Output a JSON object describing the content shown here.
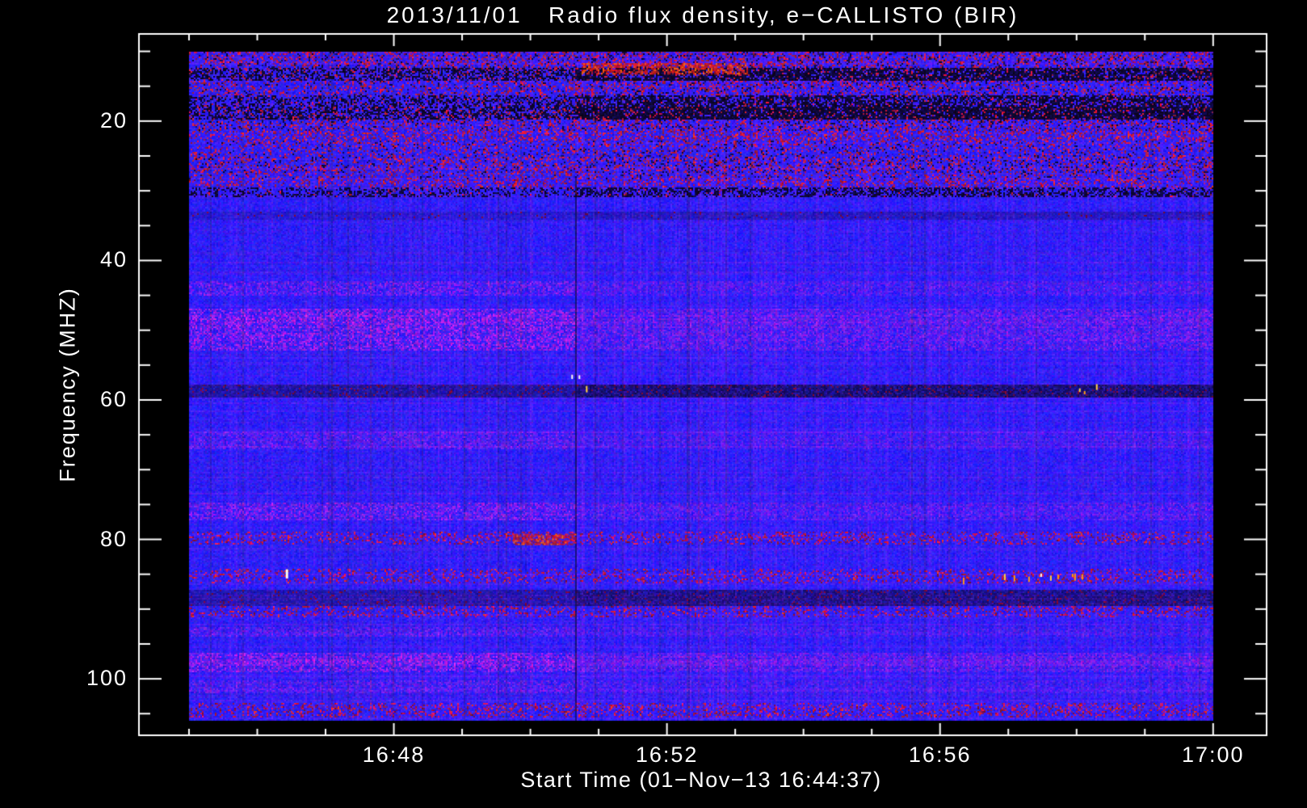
{
  "chart_data": {
    "type": "heatmap",
    "title": "2013/11/01   Radio flux density, e−CALLISTO (BIR)",
    "xlabel": "Start Time (01−Nov−13 16:44:37)",
    "ylabel": "Frequency (MHZ)",
    "x_axis": {
      "start": "16:44:16",
      "end": "17:00:47",
      "minor_step_min": 1,
      "major_ticks": [
        {
          "time": "16:48",
          "label": "16:48"
        },
        {
          "time": "16:52",
          "label": "16:52"
        },
        {
          "time": "16:56",
          "label": "16:56"
        },
        {
          "time": "17:00",
          "label": "17:00"
        }
      ]
    },
    "y_axis": {
      "min": 7.5,
      "max": 108.1,
      "unit": "MHz",
      "direction": "increasing-downward",
      "minor_step": 5,
      "major_ticks": [
        {
          "value": 20,
          "label": "20"
        },
        {
          "value": 40,
          "label": "40"
        },
        {
          "value": 60,
          "label": "60"
        },
        {
          "value": 80,
          "label": "80"
        },
        {
          "value": 100,
          "label": "100"
        }
      ]
    },
    "data_window": {
      "t0": "16:45:00",
      "t1": "17:00:00",
      "f0": 10.0,
      "f1": 106.0
    },
    "palette": {
      "background": "#000000",
      "frame": "#ffffff",
      "text": "#ffffff",
      "base_blue": "#2a2af0",
      "purple": "#7a24c8",
      "red": "#cc1616",
      "bright_red": "#ff3c00",
      "orange": "#ff9a12",
      "yellow": "#ffd440",
      "white_hot": "#fffdf0",
      "dark": "#05051e"
    },
    "segments": [
      {
        "t0": "16:45:00",
        "t1": "16:50:40",
        "purple_boost": 1.3,
        "red_striation": 0.25,
        "dark_boost": 0.75,
        "gain": 0.97
      },
      {
        "t0": "16:50:40",
        "t1": "17:00:00",
        "purple_boost": 0.8,
        "red_striation": 0.55,
        "dark_boost": 1.15,
        "gain": 1.0
      }
    ],
    "bands": [
      {
        "f0": 10.0,
        "f1": 12.3,
        "style": "noisy_red",
        "strength": 0.5
      },
      {
        "f0": 12.3,
        "f1": 14.2,
        "style": "noisy_dark",
        "strength": 0.7
      },
      {
        "f0": 14.2,
        "f1": 16.4,
        "style": "noisy_red",
        "strength": 0.4
      },
      {
        "f0": 16.4,
        "f1": 17.9,
        "style": "noisy_dark",
        "strength": 0.5
      },
      {
        "f0": 17.9,
        "f1": 19.9,
        "style": "noisy_dark",
        "strength": 0.85
      },
      {
        "f0": 19.9,
        "f1": 21.4,
        "style": "noisy_red",
        "strength": 0.5
      },
      {
        "f0": 21.4,
        "f1": 22.7,
        "style": "red_speckle",
        "strength": 0.8
      },
      {
        "f0": 22.7,
        "f1": 25.1,
        "style": "noisy_red",
        "strength": 0.3
      },
      {
        "f0": 25.1,
        "f1": 27.5,
        "style": "noisy_red",
        "strength": 0.45
      },
      {
        "f0": 27.5,
        "f1": 28.4,
        "style": "noisy_red",
        "strength": 0.3
      },
      {
        "f0": 28.4,
        "f1": 29.6,
        "style": "red_speckle",
        "strength": 0.6
      },
      {
        "f0": 29.6,
        "f1": 30.8,
        "style": "noisy_dark",
        "strength": 0.3
      },
      {
        "f0": 33.0,
        "f1": 34.2,
        "style": "dark_row",
        "strength": 0.3
      },
      {
        "f0": 43.0,
        "f1": 45.0,
        "style": "purple",
        "strength": 0.4
      },
      {
        "f0": 47.0,
        "f1": 53.0,
        "style": "purple",
        "strength": 0.55
      },
      {
        "f0": 57.8,
        "f1": 59.6,
        "style": "dark_row",
        "strength": 0.7
      },
      {
        "f0": 64.5,
        "f1": 67.0,
        "style": "purple",
        "strength": 0.3
      },
      {
        "f0": 74.8,
        "f1": 77.3,
        "style": "purple",
        "strength": 0.45
      },
      {
        "f0": 78.8,
        "f1": 80.8,
        "style": "red_speckle",
        "strength": 0.45
      },
      {
        "f0": 84.3,
        "f1": 86.4,
        "style": "red_speckle",
        "strength": 0.4
      },
      {
        "f0": 87.3,
        "f1": 89.6,
        "style": "dark_row",
        "strength": 0.6
      },
      {
        "f0": 89.6,
        "f1": 91.2,
        "style": "red_speckle",
        "strength": 0.45
      },
      {
        "f0": 92.5,
        "f1": 94.0,
        "style": "purple",
        "strength": 0.3
      },
      {
        "f0": 96.3,
        "f1": 99.0,
        "style": "purple",
        "strength": 0.5
      },
      {
        "f0": 100.3,
        "f1": 102.0,
        "style": "purple",
        "strength": 0.3
      },
      {
        "f0": 103.4,
        "f1": 105.6,
        "style": "red_speckle",
        "strength": 0.55
      }
    ],
    "events": [
      {
        "style": "red_streak",
        "t0": "16:50:45",
        "t1": "16:53:10",
        "f0": 11.7,
        "f1": 13.1,
        "label": "bright red RFI streak ~12 MHz"
      },
      {
        "style": "red_streak",
        "t0": "16:49:45",
        "t1": "16:50:40",
        "f0": 79.2,
        "f1": 80.6,
        "label": "red burst ~80 MHz"
      },
      {
        "style": "yellow_dashes",
        "t0": "16:56:20",
        "t1": "16:58:05",
        "f0": 84.8,
        "f1": 86.3,
        "label": "saturated yellow pixels ~85.5 MHz"
      },
      {
        "style": "yellow_dashes",
        "t0": "16:50:36",
        "t1": "16:50:50",
        "f0": 55.5,
        "f1": 61.5,
        "label": "bright marks at segment boundary"
      },
      {
        "style": "white_dash",
        "t0": "16:46:25",
        "t1": "16:46:33",
        "f0": 84.3,
        "f1": 85.6,
        "label": "white saturation dash"
      },
      {
        "style": "yellow_dashes",
        "t0": "16:58:00",
        "t1": "16:58:18",
        "f0": 57.0,
        "f1": 60.5,
        "label": "yellow dots ~58 MHz"
      }
    ]
  }
}
